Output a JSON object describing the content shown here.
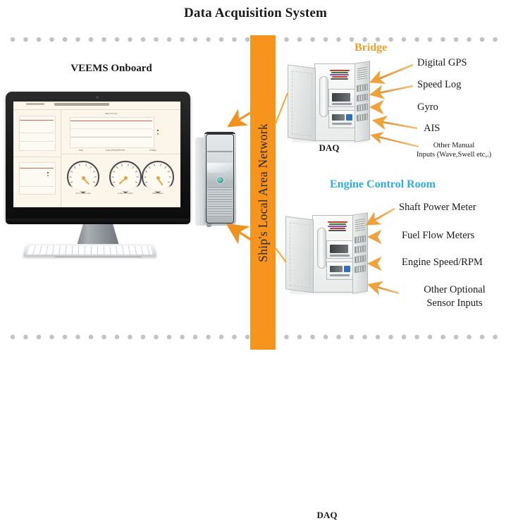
{
  "title": "Data Acquisition System",
  "network": {
    "bar_label": "Ship's Local Area Network",
    "bar_color": "#F7941E"
  },
  "left": {
    "heading": "VEEMS Onboard",
    "monitor": {
      "dashboard_title": "VECO Vs Time",
      "gauges": [
        {
          "label": "% of Total Load",
          "value_angle": -18
        },
        {
          "label": "Index at Tons/hr",
          "value_angle": -52
        },
        {
          "label": "RPM Value",
          "value_angle": 22
        }
      ],
      "legend": [
        "ACTUAL",
        "REFERENCE"
      ],
      "axis_labels": [
        "RPM",
        "FUEL CONSUMPTION",
        "POWER"
      ]
    }
  },
  "sections": [
    {
      "name": "bridge",
      "heading": "Bridge",
      "heading_color": "#F0A030",
      "device_label": "DAQ",
      "callouts": [
        "Digital GPS",
        "Speed Log",
        "Gyro",
        "AIS",
        "Other Manual\nInputs (Wave,Swell etc,.)"
      ]
    },
    {
      "name": "engine-control-room",
      "heading": "Engine Control Room",
      "heading_color": "#31ACE3",
      "device_label": "DAQ",
      "callouts": [
        "Shaft Power Meter",
        "Fuel Flow Meters",
        "Engine Speed/RPM",
        "Other Optional\nSensor Inputs"
      ]
    }
  ],
  "callouts_flat": {
    "c1": "Digital GPS",
    "c2": "Speed Log",
    "c3": "Gyro",
    "c4": "AIS",
    "c5a": "Other Manual",
    "c5b": "Inputs (Wave,Swell etc,.)",
    "c6": "Shaft Power Meter",
    "c7": "Fuel Flow Meters",
    "c8": "Engine Speed/RPM",
    "c9a": "Other Optional",
    "c9b": "Sensor Inputs"
  },
  "labels": {
    "daq_top": "DAQ",
    "daq_bottom": "DAQ"
  },
  "colors": {
    "orange": "#F7941E",
    "arrow_orange": "#F0921E",
    "blue": "#31ACE3",
    "dot_gray": "#c3c3c3",
    "text": "#1b1b1b"
  }
}
